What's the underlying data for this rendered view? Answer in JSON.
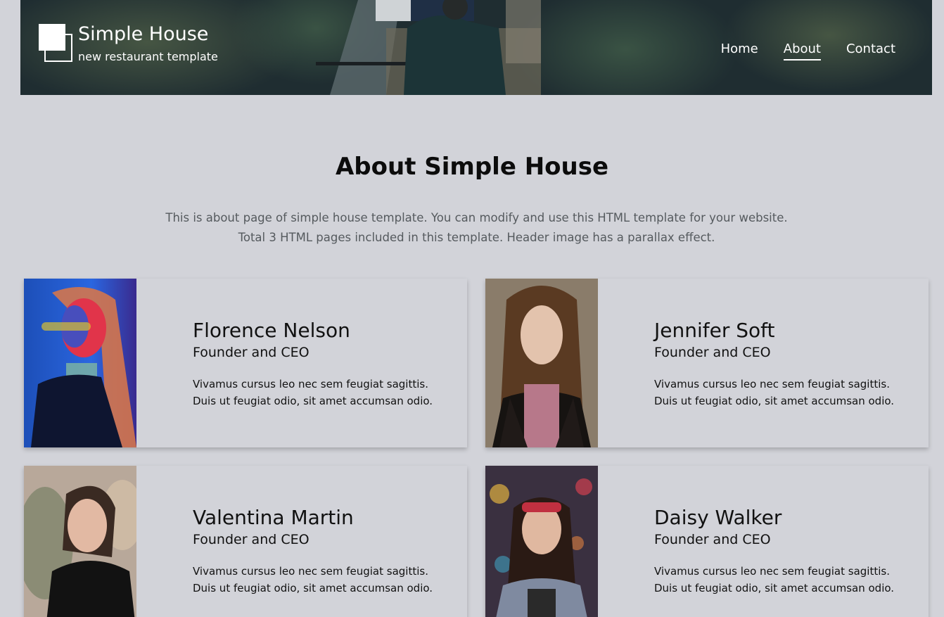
{
  "header": {
    "site_title": "Simple House",
    "site_subtitle": "new restaurant template",
    "nav": [
      {
        "label": "Home",
        "active": false
      },
      {
        "label": "About",
        "active": true
      },
      {
        "label": "Contact",
        "active": false
      }
    ]
  },
  "main": {
    "heading": "About Simple House",
    "intro_line1": "This is about page of simple house template. You can modify and use this HTML template for your website.",
    "intro_line2": "Total 3 HTML pages included in this template. Header image has a parallax effect."
  },
  "team": [
    {
      "name": "Florence Nelson",
      "role": "Founder and CEO",
      "text": "Vivamus cursus leo nec sem feugiat sagittis. Duis ut feugiat odio, sit amet accumsan odio."
    },
    {
      "name": "Jennifer Soft",
      "role": "Founder and CEO",
      "text": "Vivamus cursus leo nec sem feugiat sagittis. Duis ut feugiat odio, sit amet accumsan odio."
    },
    {
      "name": "Valentina Martin",
      "role": "Founder and CEO",
      "text": "Vivamus cursus leo nec sem feugiat sagittis. Duis ut feugiat odio, sit amet accumsan odio."
    },
    {
      "name": "Daisy Walker",
      "role": "Founder and CEO",
      "text": "Vivamus cursus leo nec sem feugiat sagittis. Duis ut feugiat odio, sit amet accumsan odio."
    }
  ],
  "colors": {
    "page_background": "#d2d3d9",
    "header_text": "#ffffff",
    "heading_text": "#0c0c0c",
    "intro_text": "#555a5e"
  }
}
